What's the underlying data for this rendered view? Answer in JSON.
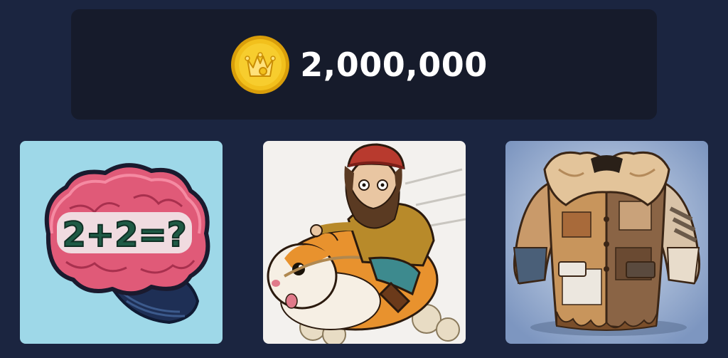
{
  "balance": {
    "amount": "2,000,000",
    "coin_icon": "crown-coin-icon",
    "coin_color": "#f2c01c"
  },
  "cards": [
    {
      "id": "brain",
      "icon": "brain-math-icon",
      "text": "2+2=?",
      "bg": "#9ed8e8"
    },
    {
      "id": "hamster",
      "icon": "hamster-rider-illustration",
      "bg": "#f3f1ee"
    },
    {
      "id": "coat",
      "icon": "fur-coat-illustration",
      "bg": "#9fb4d6"
    }
  ]
}
